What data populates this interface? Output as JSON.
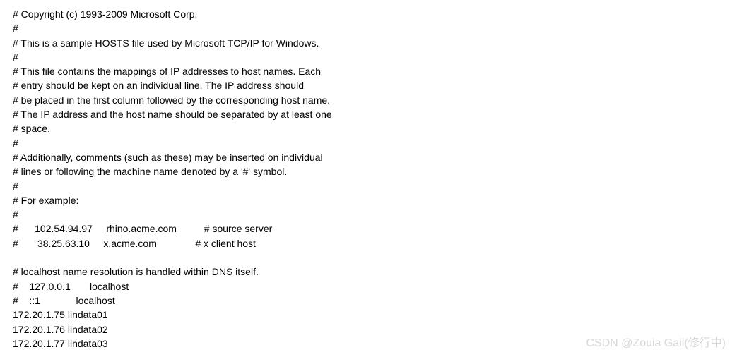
{
  "lines": [
    "# Copyright (c) 1993-2009 Microsoft Corp.",
    "#",
    "# This is a sample HOSTS file used by Microsoft TCP/IP for Windows.",
    "#",
    "# This file contains the mappings of IP addresses to host names. Each",
    "# entry should be kept on an individual line. The IP address should",
    "# be placed in the first column followed by the corresponding host name.",
    "# The IP address and the host name should be separated by at least one",
    "# space.",
    "#",
    "# Additionally, comments (such as these) may be inserted on individual",
    "# lines or following the machine name denoted by a '#' symbol.",
    "#",
    "# For example:",
    "#",
    "#      102.54.94.97     rhino.acme.com          # source server",
    "#       38.25.63.10     x.acme.com              # x client host",
    "",
    "# localhost name resolution is handled within DNS itself.",
    "#    127.0.0.1       localhost",
    "#    ::1             localhost",
    "172.20.1.75 lindata01",
    "172.20.1.76 lindata02",
    "172.20.1.77 lindata03"
  ],
  "watermark": "CSDN @Zouia  Gail(修行中)"
}
